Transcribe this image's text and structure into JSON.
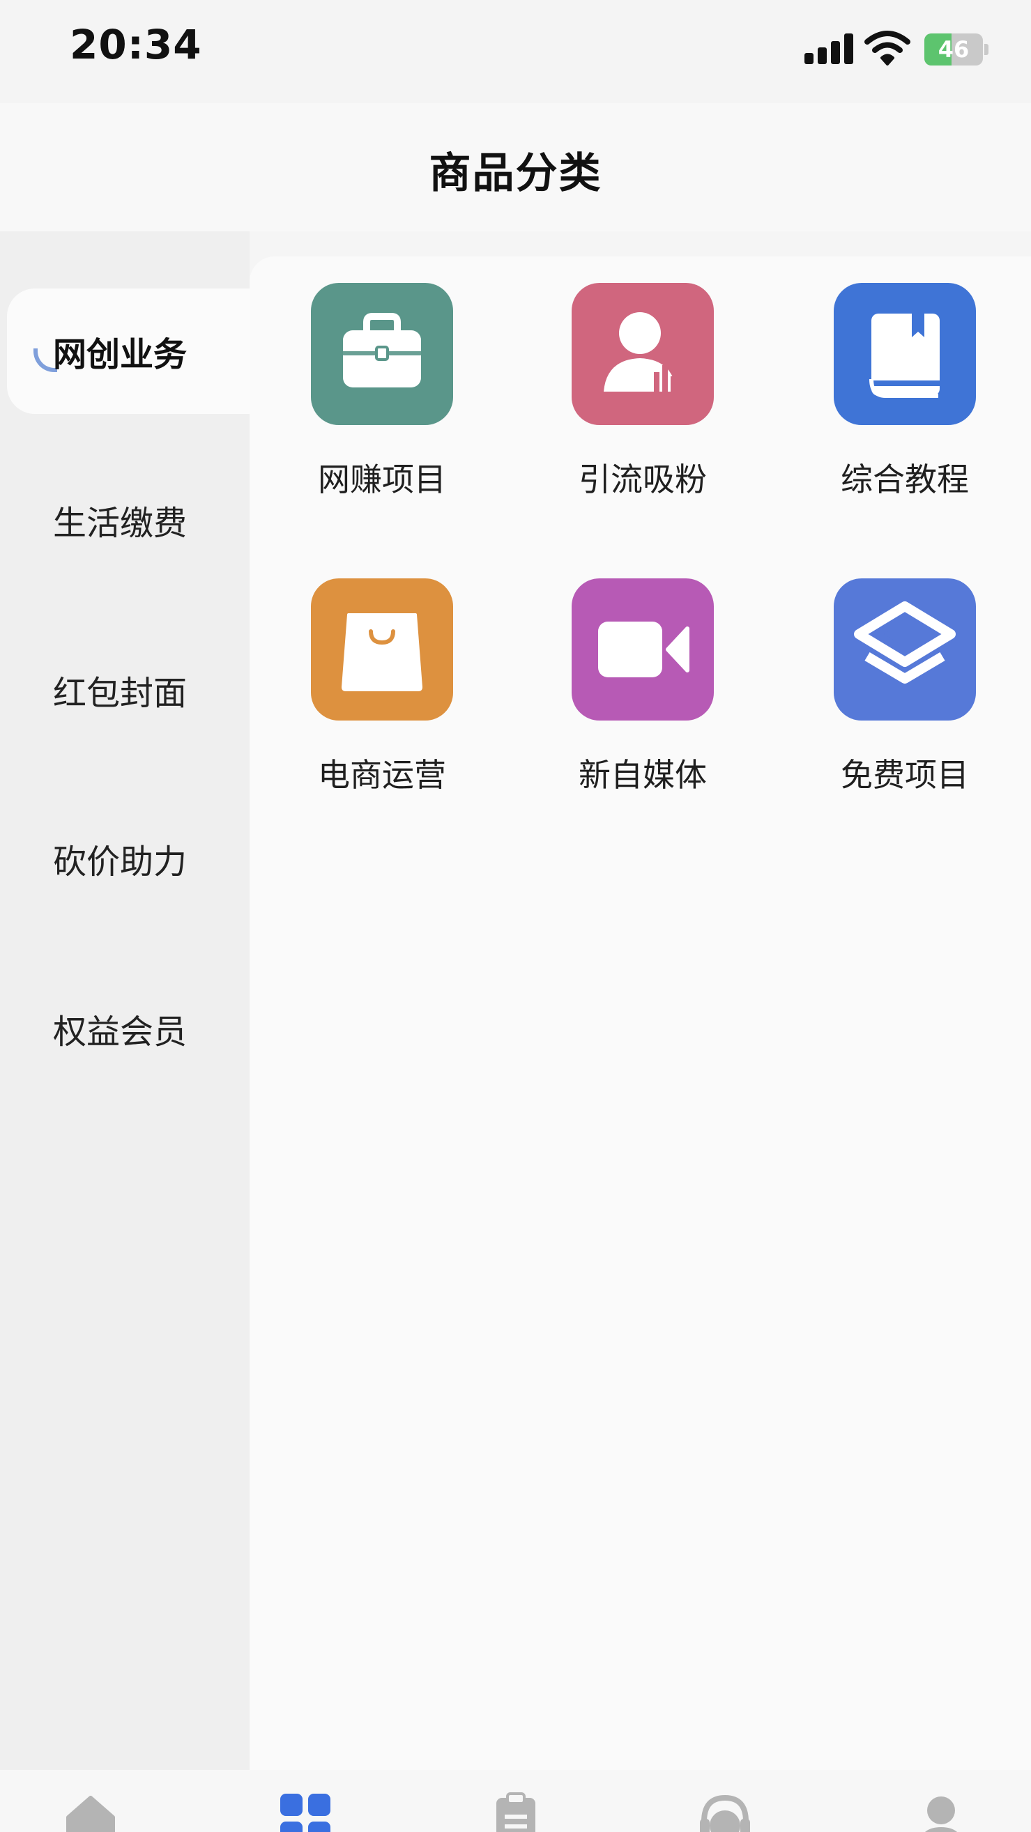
{
  "status_bar": {
    "time": "20:34",
    "battery_level": "46",
    "battery_fraction": 0.46,
    "signal_icon": "cellular-signal-icon",
    "wifi_icon": "wifi-icon",
    "battery_icon": "battery-charging-icon"
  },
  "header": {
    "title": "商品分类"
  },
  "sidebar": {
    "items": [
      {
        "label": "网创业务",
        "active": true
      },
      {
        "label": "生活缴费",
        "active": false
      },
      {
        "label": "红包封面",
        "active": false
      },
      {
        "label": "砍价助力",
        "active": false
      },
      {
        "label": "权益会员",
        "active": false
      }
    ]
  },
  "categories": [
    {
      "label": "网赚项目",
      "icon": "briefcase-icon",
      "color": "#5a968a"
    },
    {
      "label": "引流吸粉",
      "icon": "user-chart-icon",
      "color": "#d0667e"
    },
    {
      "label": "综合教程",
      "icon": "book-icon",
      "color": "#3f74d6"
    },
    {
      "label": "电商运营",
      "icon": "shopping-bag-icon",
      "color": "#dd913f"
    },
    {
      "label": "新自媒体",
      "icon": "video-camera-icon",
      "color": "#b75ab5"
    },
    {
      "label": "免费项目",
      "icon": "layers-icon",
      "color": "#5679d8"
    }
  ],
  "tabbar": {
    "tabs": [
      {
        "icon": "home-icon",
        "active": false
      },
      {
        "icon": "category-grid-icon",
        "active": true
      },
      {
        "icon": "clipboard-icon",
        "active": false
      },
      {
        "icon": "customer-service-icon",
        "active": false
      },
      {
        "icon": "profile-icon",
        "active": false
      }
    ]
  },
  "colors": {
    "accent": "#3a6fe0",
    "inactive_icon": "#b4b4b4",
    "battery_green": "#5dc46e"
  }
}
